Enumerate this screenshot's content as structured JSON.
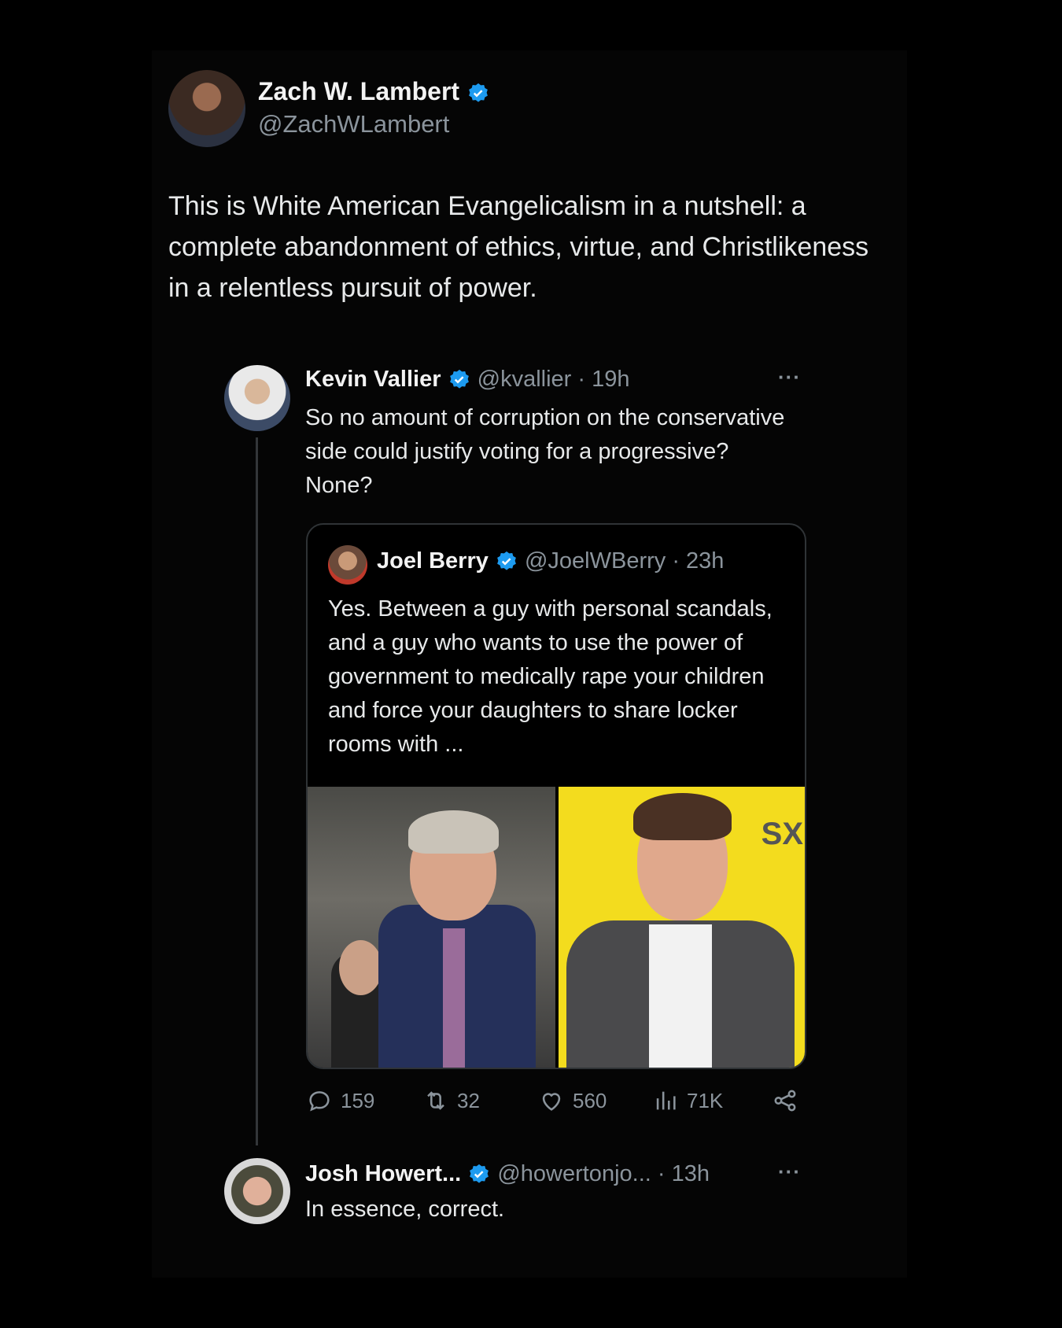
{
  "main": {
    "name": "Zach W. Lambert",
    "handle": "@ZachWLambert",
    "text": "This is White American Evangelicalism in a nutshell: a complete abandonment of ethics, virtue, and Christlikeness in a relentless pursuit of power."
  },
  "kevin": {
    "name": "Kevin Vallier",
    "handle_time": "@kvallier · 19h",
    "more": "···",
    "text": "So no amount of corruption on the conservative side could justify voting for a progressive? None?"
  },
  "quote": {
    "name": "Joel Berry",
    "handle_time": "@JoelWBerry · 23h",
    "text": "Yes. Between a guy with personal scandals, and a guy who wants to use the power of government to medically rape your children and force your daughters to share locker rooms with ...",
    "photo_right_sign": "SX"
  },
  "actions": {
    "replies": "159",
    "reposts": "32",
    "likes": "560",
    "views": "71K"
  },
  "josh": {
    "name": "Josh Howert...",
    "handle_time": "@howertonjo... · 13h",
    "more": "···",
    "text": "In essence, correct."
  },
  "colors": {
    "background": "#000000",
    "text": "#e7e9ea",
    "muted": "#8b949c",
    "verified": "#1d9bf0",
    "border": "#2f3336"
  }
}
